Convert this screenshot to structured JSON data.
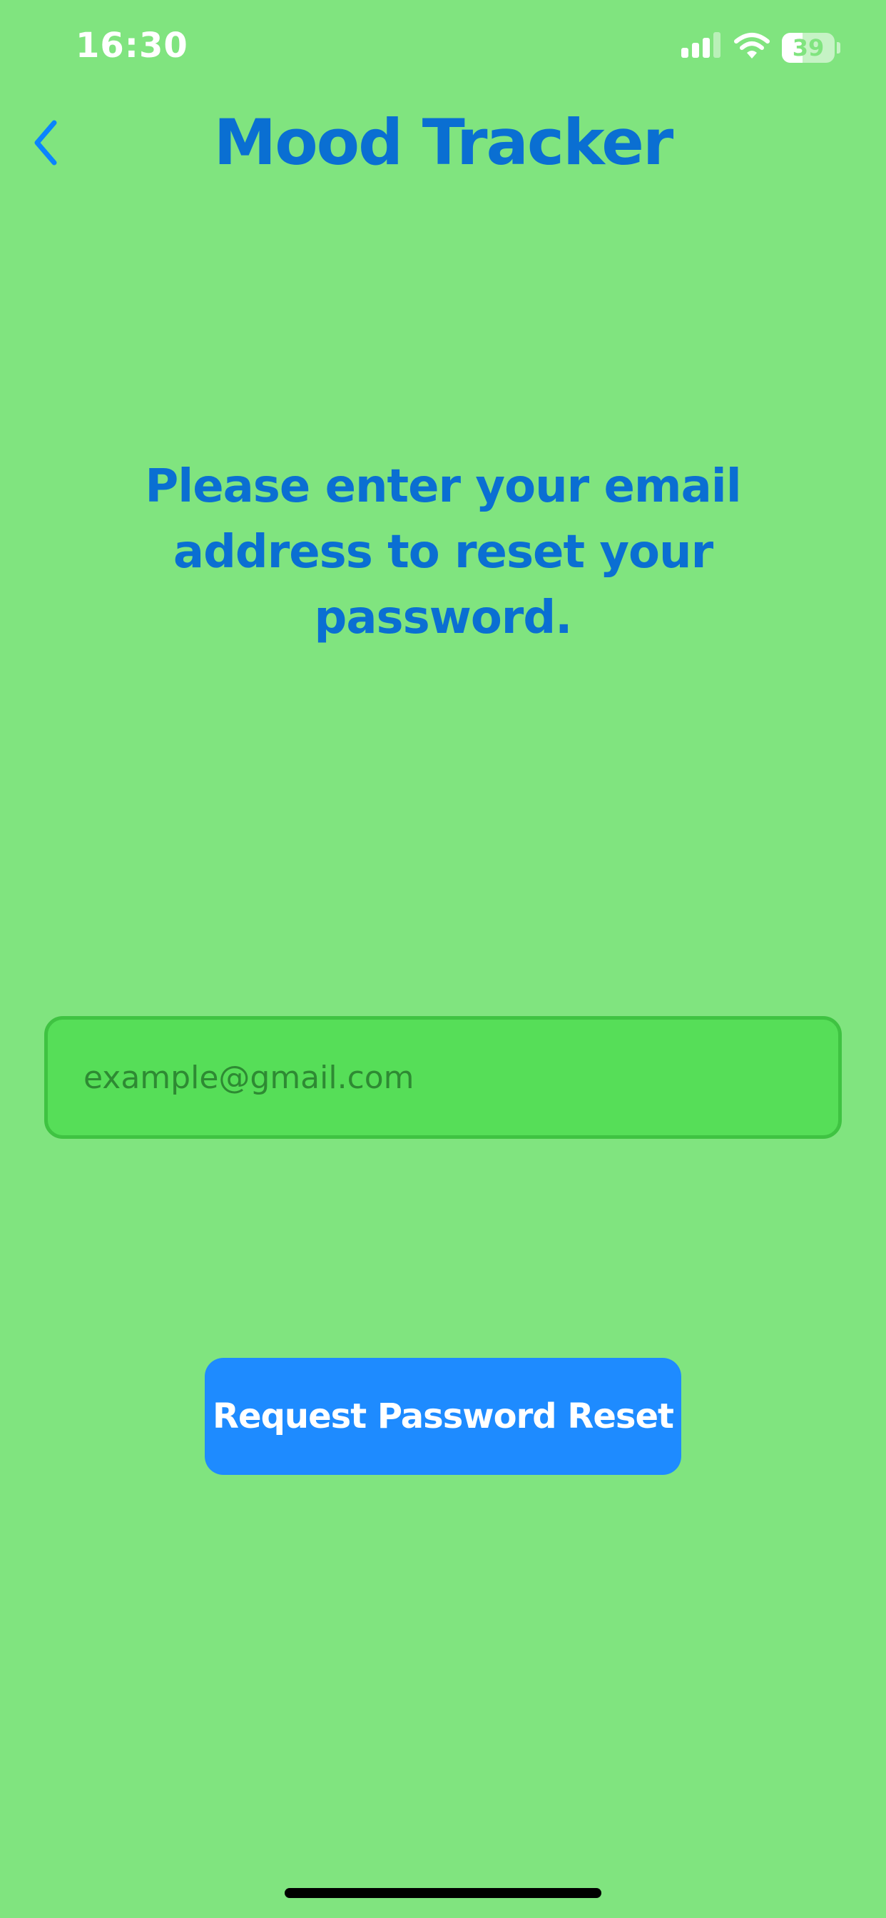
{
  "status_bar": {
    "time": "16:30",
    "battery_level": "39",
    "battery_fraction": 0.39,
    "icons": [
      "signal-icon",
      "wifi-icon",
      "battery-icon"
    ]
  },
  "nav": {
    "back_icon": "chevron-left-icon",
    "title": "Mood Tracker"
  },
  "main": {
    "instructions": "Please enter your email address to reset your password.",
    "email_placeholder": "example@gmail.com",
    "email_value": "",
    "reset_button_label": "Request Password Reset"
  },
  "colors": {
    "background": "#80e47f",
    "accent": "#0a6fd2",
    "button": "#1e8bff",
    "field_fill": "#56de58",
    "field_border": "#3fc342"
  }
}
